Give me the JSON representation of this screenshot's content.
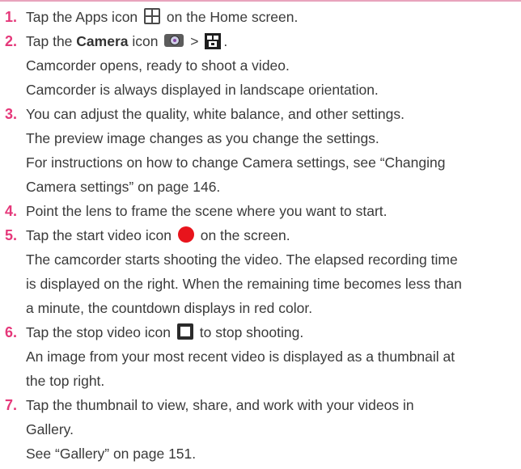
{
  "steps": [
    {
      "num": "1.",
      "pre": "Tap the Apps icon",
      "post": "on the Home screen."
    },
    {
      "num": "2.",
      "pre": "Tap the",
      "bold": "Camera",
      "mid": "icon",
      "sep": ">",
      "end": ".",
      "lines": [
        "Camcorder opens, ready to shoot a video.",
        "Camcorder is always displayed in landscape orientation."
      ]
    },
    {
      "num": "3.",
      "text": "You can adjust the quality, white balance, and other settings.",
      "lines": [
        "The preview image changes as you change the settings.",
        "For instructions on how to change Camera settings, see “Changing",
        "Camera settings” on page 146."
      ]
    },
    {
      "num": "4.",
      "text": "Point the lens to frame the scene where you want to start."
    },
    {
      "num": "5.",
      "pre": "Tap the start video icon",
      "post": "on the screen.",
      "lines": [
        "The camcorder starts shooting the video. The elapsed recording time",
        "is displayed on the right. When the remaining time becomes less than",
        "a minute, the countdown displays in red color."
      ]
    },
    {
      "num": "6.",
      "pre": "Tap the stop video icon",
      "post": "to stop shooting.",
      "lines": [
        "An image from your most recent video is displayed as a thumbnail at",
        "the top right."
      ]
    },
    {
      "num": "7.",
      "text": "Tap the thumbnail to view, share, and work with your videos in",
      "lines": [
        "Gallery.",
        "See “Gallery” on page 151."
      ]
    }
  ],
  "colors": {
    "step_number": "#e5387a",
    "top_rule": "#e8a4bc",
    "body_text": "#3a3a3a",
    "record_icon": "#e8141c"
  },
  "icons": [
    "apps-grid-icon",
    "camera-icon",
    "camcorder-icon",
    "record-icon",
    "stop-icon"
  ]
}
